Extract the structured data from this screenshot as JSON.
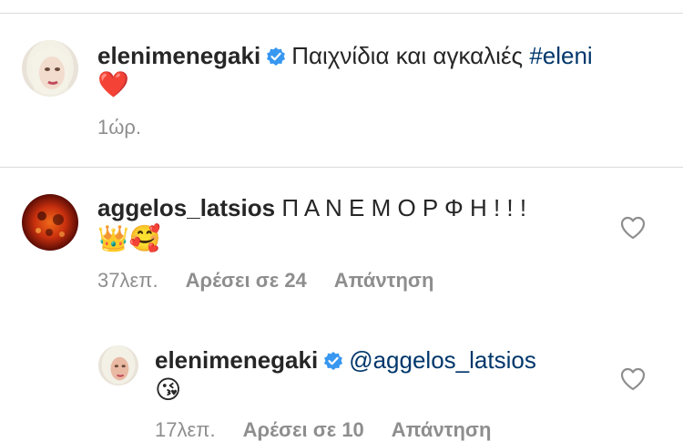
{
  "caption": {
    "username": "elenimenegaki",
    "text": "Παιχνίδια και αγκαλιές",
    "hashtag": "#eleni",
    "emoji": "❤️",
    "time": "1ώρ."
  },
  "comments": [
    {
      "username": "aggelos_latsios",
      "text": "Π Α Ν Ε Μ Ο Ρ Φ Η ! ! !",
      "emoji": "👑🥰",
      "time": "37λεπ.",
      "likes_label": "Αρέσει σε 24",
      "reply_label": "Απάντηση"
    }
  ],
  "reply": {
    "username": "elenimenegaki",
    "mention": "@aggelos_latsios",
    "emoji": "😘",
    "time": "17λεπ.",
    "likes_label": "Αρέσει σε 10",
    "reply_label": "Απάντηση"
  },
  "colors": {
    "verified": "#3897f0",
    "link": "#00376b",
    "meta": "#8e8e8e",
    "heart_emoji": "#e0245e"
  },
  "icons": {
    "verified": "verified-badge-icon",
    "like": "heart-outline-icon"
  }
}
